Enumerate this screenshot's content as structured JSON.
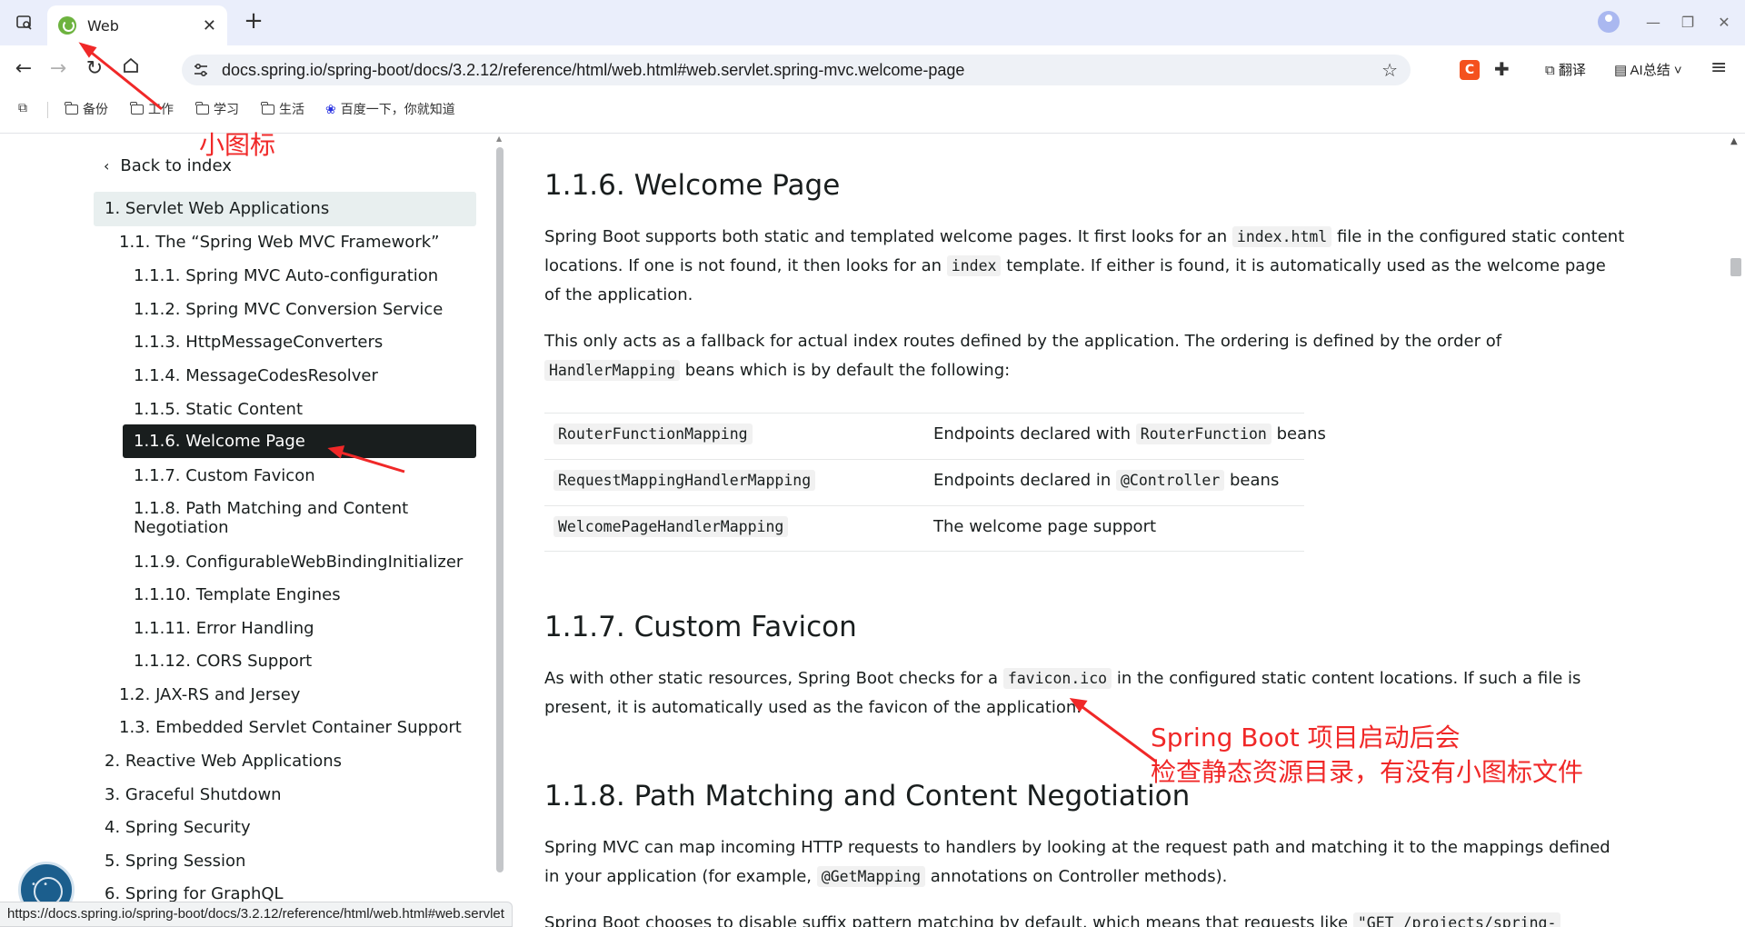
{
  "browser": {
    "tab_title": "Web",
    "tab_close": "✕",
    "new_tab": "+",
    "url": "docs.spring.io/spring-boot/docs/3.2.12/reference/html/web.html#web.servlet.spring-mvc.welcome-page",
    "ext_c": "C",
    "translate_label": "翻译",
    "ai_summary_label": "AI总结",
    "bookmarks": [
      "备份",
      "工作",
      "学习",
      "生活",
      "百度一下，你就知道"
    ]
  },
  "sidebar": {
    "back_label": "Back to index",
    "items": [
      "1. Servlet Web Applications",
      "1.1. The “Spring Web MVC Framework”",
      "1.1.1. Spring MVC Auto-configuration",
      "1.1.2. Spring MVC Conversion Service",
      "1.1.3. HttpMessageConverters",
      "1.1.4. MessageCodesResolver",
      "1.1.5. Static Content",
      "1.1.6. Welcome Page",
      "1.1.7. Custom Favicon",
      "1.1.8. Path Matching and Content",
      "Negotiation",
      "1.1.9. ConfigurableWebBindingInitializer",
      "1.1.10. Template Engines",
      "1.1.11. Error Handling",
      "1.1.12. CORS Support",
      "1.2. JAX-RS and Jersey",
      "1.3. Embedded Servlet Container Support",
      "2. Reactive Web Applications",
      "3. Graceful Shutdown",
      "4. Spring Security",
      "5. Spring Session",
      "6. Spring for GraphQL"
    ]
  },
  "status_url": "https://docs.spring.io/spring-boot/docs/3.2.12/reference/html/web.html#web.servlet",
  "content": {
    "welcome": {
      "heading": "1.1.6. Welcome Page",
      "p1_a": "Spring Boot supports both static and templated welcome pages. It first looks for an ",
      "p1_code1": "index.html",
      "p1_b": " file in the configured static content locations. If one is not found, it then looks for an ",
      "p1_code2": "index",
      "p1_c": " template. If either is found, it is automatically used as the welcome page of the application.",
      "p2_a": "This only acts as a fallback for actual index routes defined by the application. The ordering is defined by the order of ",
      "p2_code": "HandlerMapping",
      "p2_b": " beans which is by default the following:",
      "table": [
        {
          "mapping": "RouterFunctionMapping",
          "desc_a": "Endpoints declared with ",
          "desc_code": "RouterFunction",
          "desc_b": " beans"
        },
        {
          "mapping": "RequestMappingHandlerMapping",
          "desc_a": "Endpoints declared in ",
          "desc_code": "@Controller",
          "desc_b": " beans"
        },
        {
          "mapping": "WelcomePageHandlerMapping",
          "desc_a": "The welcome page support",
          "desc_code": "",
          "desc_b": ""
        }
      ]
    },
    "favicon": {
      "heading": "1.1.7. Custom Favicon",
      "p_a": "As with other static resources, Spring Boot checks for a ",
      "p_code": "favicon.ico",
      "p_b": " in the configured static content locations. If such a file is present, it is automatically used as the favicon of the application."
    },
    "path": {
      "heading": "1.1.8. Path Matching and Content Negotiation",
      "p_a": "Spring MVC can map incoming HTTP requests to handlers by looking at the request path and matching it to the mappings defined in your application (for example, ",
      "p_code": "@GetMapping",
      "p_b": " annotations on Controller methods).",
      "p2_a": "Spring Boot chooses to disable suffix pattern matching by default, which means that requests like ",
      "p2_code": "\"GET /projects/spring-"
    }
  },
  "annotations": {
    "icon_note": "小图标",
    "favicon_note_1": "Spring Boot 项目启动后会",
    "favicon_note_2": "检查静态资源目录，有没有小图标文件",
    "color": "#f02828"
  }
}
